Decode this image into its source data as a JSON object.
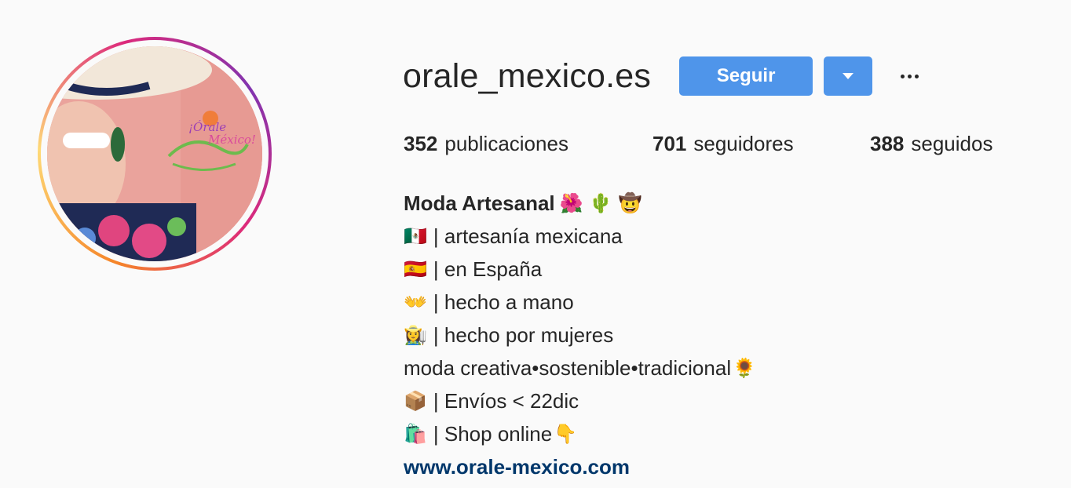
{
  "profile": {
    "username": "orale_mexico.es",
    "follow_label": "Seguir"
  },
  "stats": {
    "posts_count": "352",
    "posts_label": "publicaciones",
    "followers_count": "701",
    "followers_label": "seguidores",
    "following_count": "388",
    "following_label": "seguidos"
  },
  "bio": {
    "name": "Moda Artesanal",
    "name_emoji": "🌺 🌵 🤠",
    "lines": [
      {
        "emoji": "🇲🇽",
        "text": "| artesanía mexicana"
      },
      {
        "emoji": "🇪🇸",
        "text": "| en España"
      },
      {
        "emoji": "👐",
        "text": "| hecho a mano"
      },
      {
        "emoji": "👩‍🌾",
        "text": "| hecho por mujeres"
      },
      {
        "text": "moda creativa•sostenible•tradicional",
        "emoji_after": "🌻"
      },
      {
        "emoji": "📦",
        "text": "| Envíos < 22dic"
      },
      {
        "emoji": "🛍️",
        "text": "| Shop online",
        "emoji_after": "👇"
      }
    ],
    "website": "www.orale-mexico.com"
  },
  "avatar_logo_text": "¡Órale México!",
  "colors": {
    "button_blue": "#4f95ea",
    "link_blue": "#00376b",
    "text": "#262626",
    "background": "#fafafa"
  }
}
